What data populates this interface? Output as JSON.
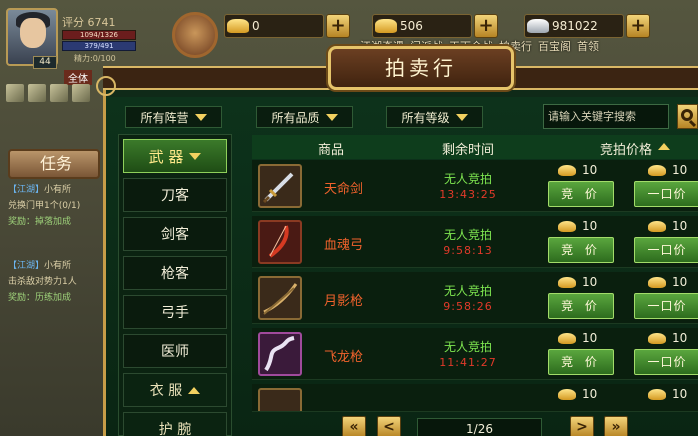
{
  "hud": {
    "score_label": "评分 6741",
    "hp": "1094/1326",
    "mp": "379/491",
    "stamina": "精力:0/100",
    "level": "44",
    "gold": "0",
    "gold_ingot": "506",
    "silver": "981022",
    "top_icons": [
      "江湖奇遇",
      "门派战",
      "天下会战",
      "拍卖行",
      "百宝阁",
      "首领"
    ],
    "all_tab": "全体",
    "quest_button": "任务",
    "quests": [
      {
        "tag": "【江湖】",
        "text": "小有所",
        "line2": "兑换门甲1个(0/1)",
        "reward": "奖励：掉落加成"
      },
      {
        "tag": "【江湖】",
        "text": "小有所",
        "line2": "击杀敌对势力1人",
        "reward": "奖励：历练加成"
      }
    ]
  },
  "auction": {
    "title": "拍卖行",
    "filters": {
      "camp": "所有阵营",
      "quality": "所有品质",
      "level": "所有等级"
    },
    "search_placeholder": "请输入关键字搜索",
    "categories": [
      {
        "label": "武 器",
        "active": true,
        "expand": "down"
      },
      {
        "label": "刀客"
      },
      {
        "label": "剑客"
      },
      {
        "label": "枪客"
      },
      {
        "label": "弓手"
      },
      {
        "label": "医师"
      },
      {
        "label": "衣 服",
        "expand": "up"
      },
      {
        "label": "护 腕"
      }
    ],
    "columns": {
      "item": "商品",
      "time": "剩余时间",
      "price": "竞拍价格"
    },
    "rows": [
      {
        "name": "天命剑",
        "status": "无人竞拍",
        "timer": "13:43:25",
        "bid_price": "10",
        "buy_price": "10",
        "bid_label": "竞 价",
        "buy_label": "一口价",
        "thumb": "sword-icon"
      },
      {
        "name": "血魂弓",
        "status": "无人竞拍",
        "timer": "9:58:13",
        "bid_price": "10",
        "buy_price": "10",
        "bid_label": "竞 价",
        "buy_label": "一口价",
        "thumb": "bow-icon"
      },
      {
        "name": "月影枪",
        "status": "无人竞拍",
        "timer": "9:58:26",
        "bid_price": "10",
        "buy_price": "10",
        "bid_label": "竞 价",
        "buy_label": "一口价",
        "thumb": "spear-icon"
      },
      {
        "name": "飞龙枪",
        "status": "无人竞拍",
        "timer": "11:41:27",
        "bid_price": "10",
        "buy_price": "10",
        "bid_label": "竞 价",
        "buy_label": "一口价",
        "thumb": "dragon-spear-icon"
      },
      {
        "name": "",
        "status": "",
        "timer": "",
        "bid_price": "10",
        "buy_price": "10",
        "bid_label": "",
        "buy_label": "",
        "thumb": "blade-icon"
      }
    ],
    "pagination": {
      "current": "1/26",
      "first": "«",
      "prev": "<",
      "next": ">",
      "last": "»"
    }
  }
}
